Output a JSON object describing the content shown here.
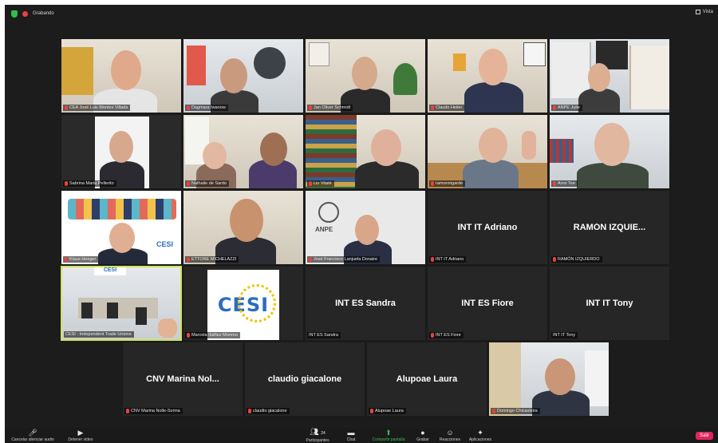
{
  "topbar": {
    "recording_label": "Grabando",
    "view_label": "Vista"
  },
  "tiles_row1": [
    {
      "name": "CEA José Luis Montes Villada"
    },
    {
      "name": "Dagmara Iwanow"
    },
    {
      "name": "Jan Oliver Schmidt"
    },
    {
      "name": "Claude Heiler"
    },
    {
      "name": "ANPE Julie"
    }
  ],
  "tiles_row2": [
    {
      "name": "Sabrina Maria Pellerito"
    },
    {
      "name": "Nathalie de Sardo"
    },
    {
      "name": "Lio Vitalé"
    },
    {
      "name": "ramonmgarde"
    },
    {
      "name": "Arno Tee"
    }
  ],
  "tiles_row3": [
    {
      "name": "Klaus Heeger"
    },
    {
      "name": "ETTORE MICHELAZZI"
    },
    {
      "name": "José Francisco Lanjuela Donaire",
      "logo_text": "ANPE"
    },
    {
      "name": "INT IT Adriano",
      "center": "INT IT Adriano"
    },
    {
      "name": "RAMÓN IZQUIERDO",
      "center": "RAMÓN IZQUIE..."
    }
  ],
  "tiles_row4": [
    {
      "name": "CESI - Independent Trade Unions"
    },
    {
      "name": "Marcela Ibáñez Moreno",
      "logo_text": "CESI"
    },
    {
      "name": "INT ES Sandra",
      "center": "INT ES Sandra"
    },
    {
      "name": "INT ES Fiore",
      "center": "INT ES Fiore"
    },
    {
      "name": "INT IT Tony",
      "center": "INT IT Tony"
    }
  ],
  "tiles_row5": [
    {
      "name": "CNV Marina Nolle-Sorina",
      "center": "CNV Marina Nol..."
    },
    {
      "name": "claudio giacalone",
      "center": "claudio giacalone"
    },
    {
      "name": "Alupoae Laura",
      "center": "Alupoae Laura"
    },
    {
      "name": "Domingo Chicavieira"
    }
  ],
  "toolbar": {
    "unmute": "Cancelar silenciar audio",
    "video": "Detener video",
    "participants": "Participantes",
    "participants_count": "24",
    "chat": "Chat",
    "share": "Compartir pantalla",
    "record": "Grabar",
    "reactions": "Reacciones",
    "apps": "Aplicaciones",
    "leave": "Salir"
  },
  "colors": {
    "recording": "#e8423d",
    "share": "#2fbf4e",
    "leave": "#e0245e",
    "active_speaker": "#cfe35a"
  }
}
